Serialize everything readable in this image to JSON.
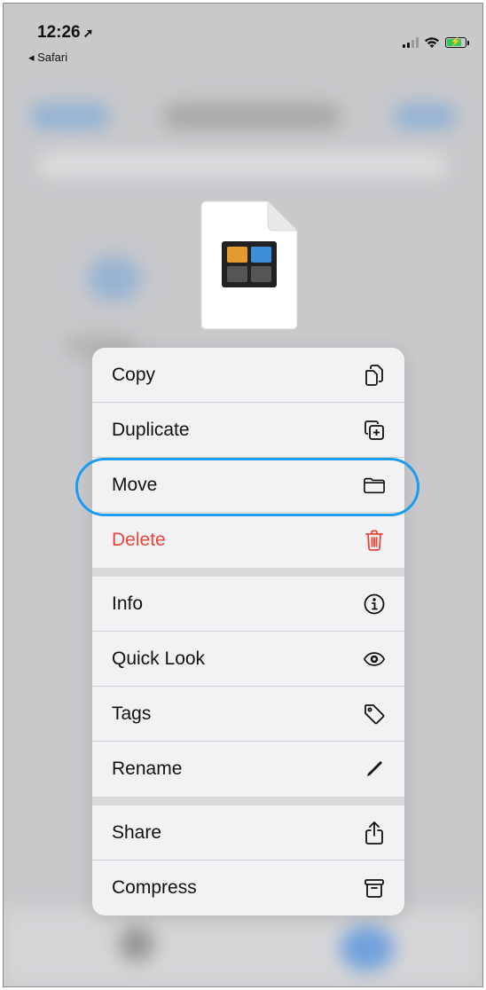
{
  "status_bar": {
    "time": "12:26",
    "location_arrow": "➚",
    "back_app": "◂ Safari"
  },
  "file": {
    "icon": "document-icon"
  },
  "menu": {
    "group1": [
      {
        "label": "Copy",
        "icon": "copy-icon"
      },
      {
        "label": "Duplicate",
        "icon": "duplicate-icon"
      },
      {
        "label": "Move",
        "icon": "folder-icon"
      },
      {
        "label": "Delete",
        "icon": "trash-icon"
      }
    ],
    "group2": [
      {
        "label": "Info",
        "icon": "info-icon"
      },
      {
        "label": "Quick Look",
        "icon": "eye-icon"
      },
      {
        "label": "Tags",
        "icon": "tag-icon"
      },
      {
        "label": "Rename",
        "icon": "pencil-icon"
      }
    ],
    "group3": [
      {
        "label": "Share",
        "icon": "share-icon"
      },
      {
        "label": "Compress",
        "icon": "archive-icon"
      }
    ]
  },
  "colors": {
    "destructive": "#e5473b",
    "highlight": "#1a9cf0",
    "battery": "#34c759"
  }
}
